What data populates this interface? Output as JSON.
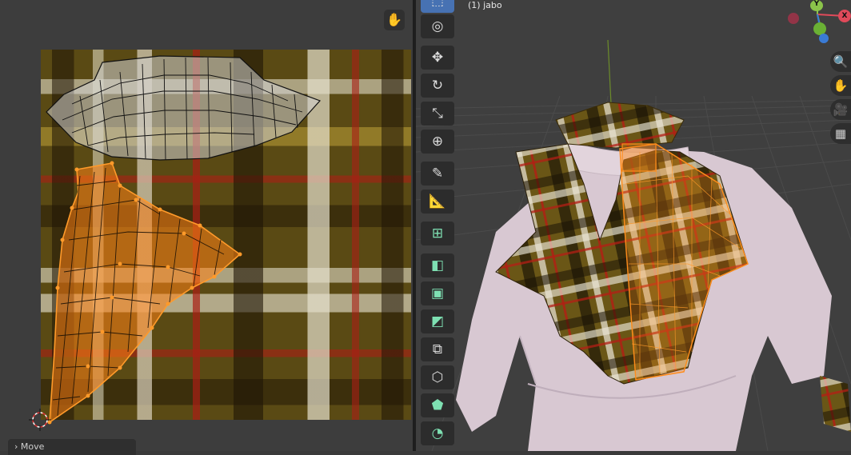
{
  "header": {
    "object_label": "(1) jabo"
  },
  "panel": {
    "last_operator": "Move"
  },
  "gizmo": {
    "x_label": "X",
    "y_label": "Y"
  },
  "colors": {
    "selection": "#ff8c1a",
    "active_tool": "#4772b3",
    "background": "#3d3d3d",
    "plaid_base": "#5a4a14",
    "shirt": "#d8c8d2"
  },
  "icons": {
    "uv_editor": [
      "pan-hand-icon"
    ],
    "toolbar": [
      "select-box-icon",
      "cursor-icon",
      "move-icon",
      "rotate-icon",
      "scale-icon",
      "transform-icon",
      "annotate-icon",
      "measure-icon",
      "add-cube-icon",
      "extrude-icon",
      "inset-icon",
      "bevel-icon",
      "loop-cut-icon",
      "knife-icon",
      "poly-build-icon",
      "spin-icon"
    ],
    "viewport_nav": [
      "zoom-icon",
      "pan-hand-icon",
      "camera-icon",
      "grid-perspective-icon"
    ]
  }
}
